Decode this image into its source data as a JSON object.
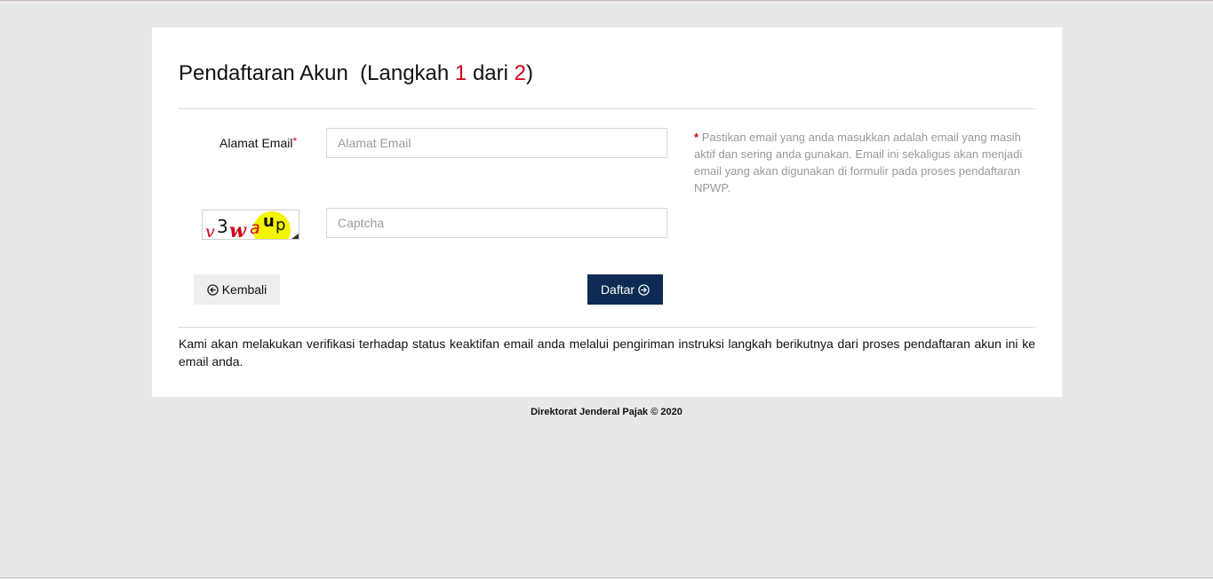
{
  "form": {
    "title_prefix": "Pendaftaran Akun",
    "title_step_open": "(Langkah ",
    "title_step_current": "1",
    "title_step_mid": " dari ",
    "title_step_total": "2",
    "title_step_close": ")",
    "email_label": "Alamat Email",
    "required_mark": "*",
    "email_placeholder": "Alamat Email",
    "email_value": "",
    "captcha_text": "v3waup",
    "captcha_placeholder": "Captcha",
    "captcha_value": "",
    "note_star": "*",
    "note_text": "Pastikan email yang anda masukkan adalah email yang masih aktif dan sering anda gunakan. Email ini sekaligus akan menjadi email yang akan digunakan di formulir pada proses pendaftaran NPWP.",
    "back_label": "Kembali",
    "submit_label": "Daftar",
    "info_text": "Kami akan melakukan verifikasi terhadap status keaktifan email anda melalui pengiriman instruksi langkah berikutnya dari proses pendaftaran akun ini ke email anda."
  },
  "footer": {
    "text": "Direktorat Jenderal Pajak © 2020"
  },
  "colors": {
    "accent_red": "#d0021b",
    "primary_button": "#0c2a52"
  },
  "icons": {
    "back": "arrow-left-circle-icon",
    "submit": "arrow-right-circle-icon"
  }
}
